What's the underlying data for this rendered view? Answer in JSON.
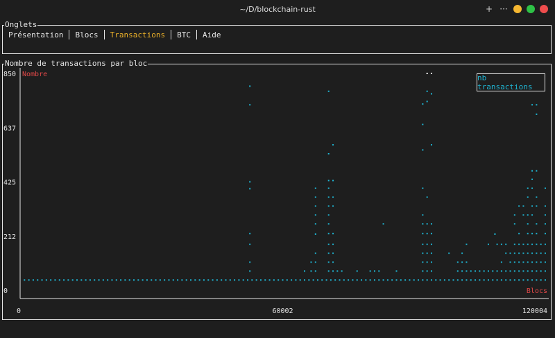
{
  "window": {
    "title": "~/D/blockchain-rust",
    "controls": {
      "new": "+",
      "more": "···"
    }
  },
  "tabs": {
    "title": "Onglets",
    "items": [
      {
        "label": "Présentation",
        "active": false
      },
      {
        "label": "Blocs",
        "active": false
      },
      {
        "label": "Transactions",
        "active": true
      },
      {
        "label": "BTC",
        "active": false
      },
      {
        "label": "Aide",
        "active": false
      }
    ]
  },
  "chart_data": {
    "type": "scatter",
    "title": "Nombre de transactions par bloc",
    "ylabel": "Nombre",
    "xlabel": "Blocs",
    "legend": {
      "entries": [
        "nb transactions"
      ],
      "placement": "top-right"
    },
    "xlim": [
      0,
      120004
    ],
    "ylim": [
      0,
      850
    ],
    "xticks": [
      "0",
      "60002",
      "120004"
    ],
    "yticks": [
      "0",
      "212",
      "425",
      "637",
      "850"
    ],
    "colors": {
      "series": "#1fb6d4",
      "axis_title": "#e04848",
      "axis": "#e6e6e6"
    },
    "series": [
      {
        "name": "nb transactions",
        "points": [
          [
            52500,
            800
          ],
          [
            52500,
            727
          ],
          [
            52500,
            425
          ],
          [
            52500,
            398
          ],
          [
            52500,
            222
          ],
          [
            52500,
            180
          ],
          [
            52500,
            110
          ],
          [
            52500,
            75
          ],
          [
            67500,
            400
          ],
          [
            67500,
            365
          ],
          [
            67500,
            330
          ],
          [
            67500,
            295
          ],
          [
            67500,
            260
          ],
          [
            67500,
            220
          ],
          [
            67500,
            145
          ],
          [
            67500,
            110
          ],
          [
            67500,
            75
          ],
          [
            66500,
            110
          ],
          [
            66500,
            75
          ],
          [
            65000,
            75
          ],
          [
            70500,
            780
          ],
          [
            70500,
            535
          ],
          [
            70500,
            430
          ],
          [
            70500,
            400
          ],
          [
            70500,
            365
          ],
          [
            70500,
            330
          ],
          [
            70500,
            295
          ],
          [
            70500,
            260
          ],
          [
            70500,
            222
          ],
          [
            70500,
            180
          ],
          [
            70500,
            145
          ],
          [
            70500,
            110
          ],
          [
            70500,
            75
          ],
          [
            71500,
            570
          ],
          [
            71500,
            430
          ],
          [
            71500,
            365
          ],
          [
            71500,
            330
          ],
          [
            71500,
            222
          ],
          [
            71500,
            180
          ],
          [
            71500,
            145
          ],
          [
            71500,
            110
          ],
          [
            71500,
            75
          ],
          [
            72500,
            75
          ],
          [
            73500,
            75
          ],
          [
            77000,
            75
          ],
          [
            80000,
            75
          ],
          [
            81000,
            75
          ],
          [
            82000,
            75
          ],
          [
            83000,
            260
          ],
          [
            86000,
            75
          ],
          [
            92000,
            730
          ],
          [
            92000,
            650
          ],
          [
            92000,
            550
          ],
          [
            92000,
            400
          ],
          [
            92000,
            295
          ],
          [
            92000,
            260
          ],
          [
            92000,
            222
          ],
          [
            92000,
            180
          ],
          [
            92000,
            145
          ],
          [
            92000,
            110
          ],
          [
            92000,
            75
          ],
          [
            93000,
            850
          ],
          [
            93000,
            780
          ],
          [
            93000,
            740
          ],
          [
            93000,
            365
          ],
          [
            93000,
            260
          ],
          [
            93000,
            222
          ],
          [
            93000,
            180
          ],
          [
            93000,
            145
          ],
          [
            93000,
            110
          ],
          [
            93000,
            75
          ],
          [
            94000,
            850
          ],
          [
            94000,
            770
          ],
          [
            94000,
            570
          ],
          [
            94000,
            260
          ],
          [
            94000,
            222
          ],
          [
            94000,
            180
          ],
          [
            94000,
            145
          ],
          [
            94000,
            110
          ],
          [
            94000,
            75
          ],
          [
            98000,
            145
          ],
          [
            100000,
            110
          ],
          [
            100000,
            75
          ],
          [
            101000,
            145
          ],
          [
            101000,
            110
          ],
          [
            101000,
            75
          ],
          [
            102000,
            180
          ],
          [
            102000,
            110
          ],
          [
            102000,
            75
          ],
          [
            103000,
            75
          ],
          [
            104000,
            75
          ],
          [
            105000,
            75
          ],
          [
            106000,
            75
          ],
          [
            107000,
            180
          ],
          [
            107000,
            75
          ],
          [
            108000,
            75
          ],
          [
            108500,
            220
          ],
          [
            109000,
            180
          ],
          [
            109000,
            75
          ],
          [
            110000,
            180
          ],
          [
            110000,
            110
          ],
          [
            110000,
            75
          ],
          [
            111000,
            180
          ],
          [
            111000,
            145
          ],
          [
            111000,
            75
          ],
          [
            112000,
            145
          ],
          [
            112000,
            110
          ],
          [
            112000,
            75
          ],
          [
            113000,
            295
          ],
          [
            113000,
            260
          ],
          [
            113000,
            180
          ],
          [
            113000,
            145
          ],
          [
            113000,
            110
          ],
          [
            113000,
            75
          ],
          [
            114000,
            330
          ],
          [
            114000,
            222
          ],
          [
            114000,
            180
          ],
          [
            114000,
            145
          ],
          [
            114000,
            110
          ],
          [
            114000,
            75
          ],
          [
            115000,
            330
          ],
          [
            115000,
            295
          ],
          [
            115000,
            180
          ],
          [
            115000,
            145
          ],
          [
            115000,
            110
          ],
          [
            115000,
            75
          ],
          [
            116000,
            400
          ],
          [
            116000,
            365
          ],
          [
            116000,
            295
          ],
          [
            116000,
            260
          ],
          [
            116000,
            222
          ],
          [
            116000,
            180
          ],
          [
            116000,
            145
          ],
          [
            116000,
            110
          ],
          [
            116000,
            75
          ],
          [
            117000,
            727
          ],
          [
            117000,
            468
          ],
          [
            117000,
            435
          ],
          [
            117000,
            400
          ],
          [
            117000,
            330
          ],
          [
            117000,
            295
          ],
          [
            117000,
            222
          ],
          [
            117000,
            180
          ],
          [
            117000,
            145
          ],
          [
            117000,
            110
          ],
          [
            117000,
            75
          ],
          [
            118000,
            727
          ],
          [
            118000,
            690
          ],
          [
            118000,
            468
          ],
          [
            118000,
            365
          ],
          [
            118000,
            330
          ],
          [
            118000,
            260
          ],
          [
            118000,
            222
          ],
          [
            118000,
            180
          ],
          [
            118000,
            145
          ],
          [
            118000,
            110
          ],
          [
            118000,
            75
          ],
          [
            119000,
            180
          ],
          [
            119000,
            145
          ],
          [
            119000,
            110
          ],
          [
            119000,
            75
          ],
          [
            120000,
            400
          ],
          [
            120000,
            330
          ],
          [
            120000,
            295
          ],
          [
            120000,
            260
          ],
          [
            120000,
            222
          ],
          [
            120000,
            180
          ],
          [
            120000,
            145
          ],
          [
            120000,
            110
          ],
          [
            120000,
            75
          ]
        ],
        "baseline": {
          "y": 40,
          "x_start": 1000,
          "x_end": 120004,
          "step": 1000
        }
      }
    ]
  }
}
